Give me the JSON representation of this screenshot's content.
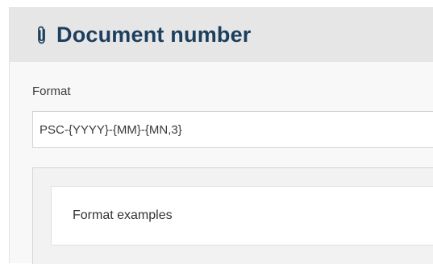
{
  "header": {
    "title": "Document number",
    "icon": "paperclip-icon",
    "title_color": "#1c3f5e"
  },
  "format_field": {
    "label": "Format",
    "value": "PSC-{YYYY}-{MM}-{MN,3}"
  },
  "examples": {
    "title": "Format examples"
  }
}
